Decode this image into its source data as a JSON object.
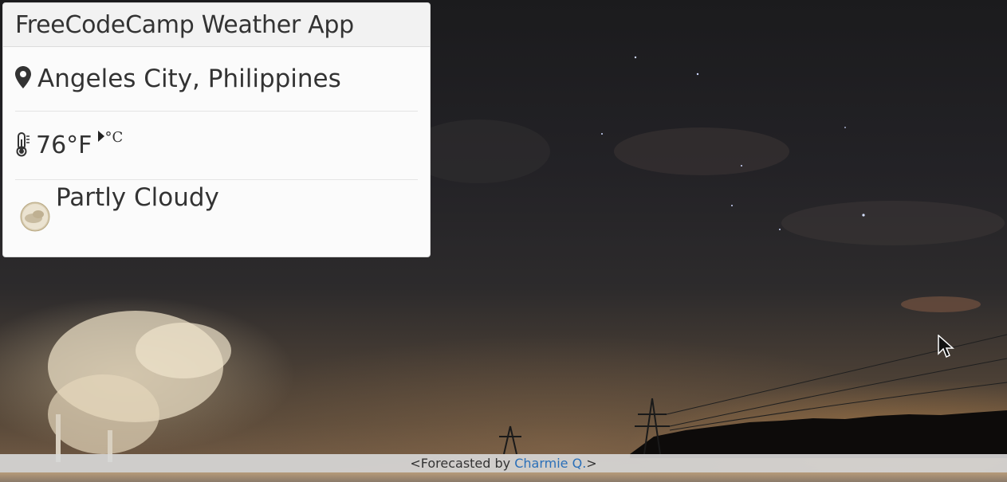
{
  "app": {
    "title": "FreeCodeCamp Weather App"
  },
  "location": {
    "icon": "map-marker-icon",
    "text": "Angeles City, Philippines"
  },
  "temperature": {
    "icon": "thermometer-icon",
    "value": "76°F",
    "toggle_icon": "caret-right-icon",
    "toggle_label": "°C"
  },
  "condition": {
    "icon": "partly-cloudy-icon",
    "text": "Partly Cloudy"
  },
  "footer": {
    "prefix": "<Forecasted by ",
    "author": "Charmie Q.",
    "suffix": ">",
    "link_color": "#2a6fb8"
  }
}
